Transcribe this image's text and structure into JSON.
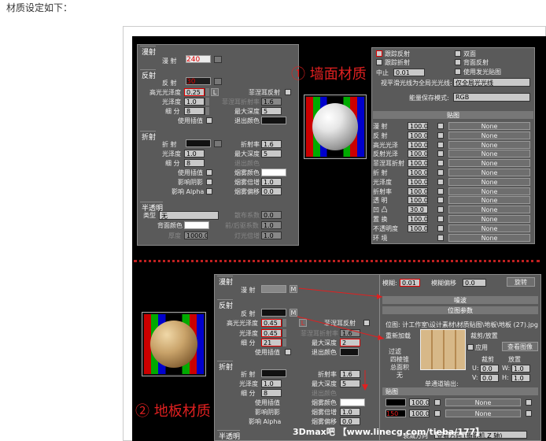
{
  "intro": "材质设定如下：",
  "wall": {
    "label": "① 墙面材质",
    "diffuse": {
      "section": "漫射",
      "label": "漫 射",
      "value": "240"
    },
    "reflect": {
      "section": "反射",
      "label": "反 射",
      "value": "30",
      "hilight_label": "高光光泽度",
      "hilight": "0.25",
      "lock": "L",
      "fresnel": "菲涅耳反射",
      "gloss_label": "光泽度",
      "gloss": "1.0",
      "fresnel_ior_label": "菲涅耳折射率",
      "fresnel_ior": "1.6",
      "subdiv_label": "细 分",
      "subdiv": "8",
      "maxdepth_label": "最大深度",
      "maxdepth": "5",
      "interp": "使用插值",
      "exitcolor": "退出颜色"
    },
    "refract": {
      "section": "折射",
      "label": "折 射",
      "ior_label": "折射率",
      "ior": "1.6",
      "gloss_label": "光泽度",
      "gloss": "1.0",
      "maxdepth_label": "最大深度",
      "maxdepth": "5",
      "subdiv_label": "细 分",
      "subdiv": "8",
      "exitcolor": "退出颜色",
      "interp": "使用插值",
      "fogcolor": "烟雾颜色",
      "shadows": "影响阴影",
      "fogmult_label": "烟雾倍增",
      "fogmult": "1.0",
      "alpha": "影响 Alpha",
      "fogbias_label": "烟雾偏移",
      "fogbias": "0.0"
    },
    "translucent": {
      "section": "半透明",
      "type_label": "类型",
      "type": "无",
      "backcolor": "背面颜色",
      "thick_label": "厚度",
      "thick": "1000.0",
      "scatter_label": "散布系数",
      "scatter": "0.0",
      "fb_label": "前/后驱系数",
      "fb": "1.0",
      "light_label": "灯光倍增",
      "light": "1.0"
    },
    "options": {
      "trace_reflect": "跟踪反射",
      "trace_refract": "跟踪折射",
      "cutoff_label": "中止",
      "cutoff": "0.01",
      "double": "双面",
      "backside": "背面反射",
      "glossy_map": "使用发光贴图",
      "treat_label": "视平滑光线为全局光光线:",
      "treat": "仅全局光光线",
      "energy_label": "能量保存模式:",
      "energy": "RGB"
    },
    "maps_title": "贴图",
    "maps": [
      {
        "name": "漫 射",
        "amt": "100.0",
        "map": "None"
      },
      {
        "name": "反 射",
        "amt": "100.0",
        "map": "None"
      },
      {
        "name": "高光光泽",
        "amt": "100.0",
        "map": "None"
      },
      {
        "name": "反射光泽",
        "amt": "100.0",
        "map": "None"
      },
      {
        "name": "菲涅耳折射",
        "amt": "100.0",
        "map": "None"
      },
      {
        "name": "折 射",
        "amt": "100.0",
        "map": "None"
      },
      {
        "name": "光泽度",
        "amt": "100.0",
        "map": "None"
      },
      {
        "name": "折射率",
        "amt": "100.0",
        "map": "None"
      },
      {
        "name": "透 明",
        "amt": "100.0",
        "map": "None"
      },
      {
        "name": "凹 凸",
        "amt": "30.0",
        "map": "None"
      },
      {
        "name": "置 换",
        "amt": "100.0",
        "map": "None"
      },
      {
        "name": "不透明度",
        "amt": "100.0",
        "map": "None"
      },
      {
        "name": "环 境",
        "amt": "",
        "map": "None"
      }
    ]
  },
  "floor": {
    "label": "② 地板材质",
    "diffuse": {
      "section": "漫射",
      "label": "漫 射",
      "mapbtn": "M"
    },
    "reflect": {
      "section": "反射",
      "label": "反 射",
      "mapbtn": "M",
      "hilight_label": "高光光泽度",
      "hilight": "0.45",
      "lock": "L",
      "fresnel": "菲涅耳反射",
      "gloss_label": "光泽度",
      "gloss": "0.45",
      "fresnel_ior_label": "菲涅耳折射率",
      "fresnel_ior": "1.6",
      "subdiv_label": "细 分",
      "subdiv": "21",
      "maxdepth_label": "最大深度",
      "maxdepth": "2",
      "interp": "使用插值",
      "exitcolor": "退出颜色"
    },
    "refract": {
      "section": "折射",
      "label": "折 射",
      "ior_label": "折射率",
      "ior": "1.6",
      "gloss_label": "光泽度",
      "gloss": "1.0",
      "maxdepth_label": "最大深度",
      "maxdepth": "5",
      "subdiv_label": "细 分",
      "subdiv": "8",
      "exitcolor": "退出颜色",
      "interp": "使用插值",
      "fogcolor": "烟雾颜色",
      "shadows": "影响阴影",
      "fogmult_label": "烟雾倍增",
      "fogmult": "1.0",
      "alpha": "影响 Alpha",
      "fogbias_label": "烟雾偏移",
      "fogbias": "0.0"
    },
    "translucent": {
      "section": "半透明"
    },
    "bitmap": {
      "blur_label": "模糊:",
      "blur": "0.01",
      "offset_label": "模糊偏移",
      "offset": "0.0",
      "rotate": "旋转",
      "noise": "噪波",
      "params": "位图参数",
      "path": "位图: 计工作室\\设计素材\\材质贴图\\地板\\地板 (27).jpg",
      "reload": "重新加载",
      "crop": "裁剪/放置",
      "apply": "应用",
      "view": "查看图像",
      "filter": "过滤",
      "filter_opt1": "四棱锥",
      "filter_opt2": "总面积",
      "filter_opt3": "无",
      "crop_opt": "裁剪",
      "place_opt": "放置",
      "u_label": "U:",
      "u": "0.0",
      "w_label": "W:",
      "w": "1.0",
      "v_label": "V:",
      "v": "0.0",
      "h_label": "H:",
      "h": "1.0",
      "mono": "单通道输出:",
      "rgb_title": "贴图"
    },
    "maps": [
      {
        "amt": "100.0",
        "map": "None"
      },
      {
        "amt": "100.0",
        "map": "None"
      }
    ],
    "red_value": "150",
    "bottom_text": "衰减方向",
    "bottom_value": "查看方向 (摄影机 Z 轴)"
  },
  "watermark": "3Dmax吧  【www.linecg.com/tieba/177】"
}
